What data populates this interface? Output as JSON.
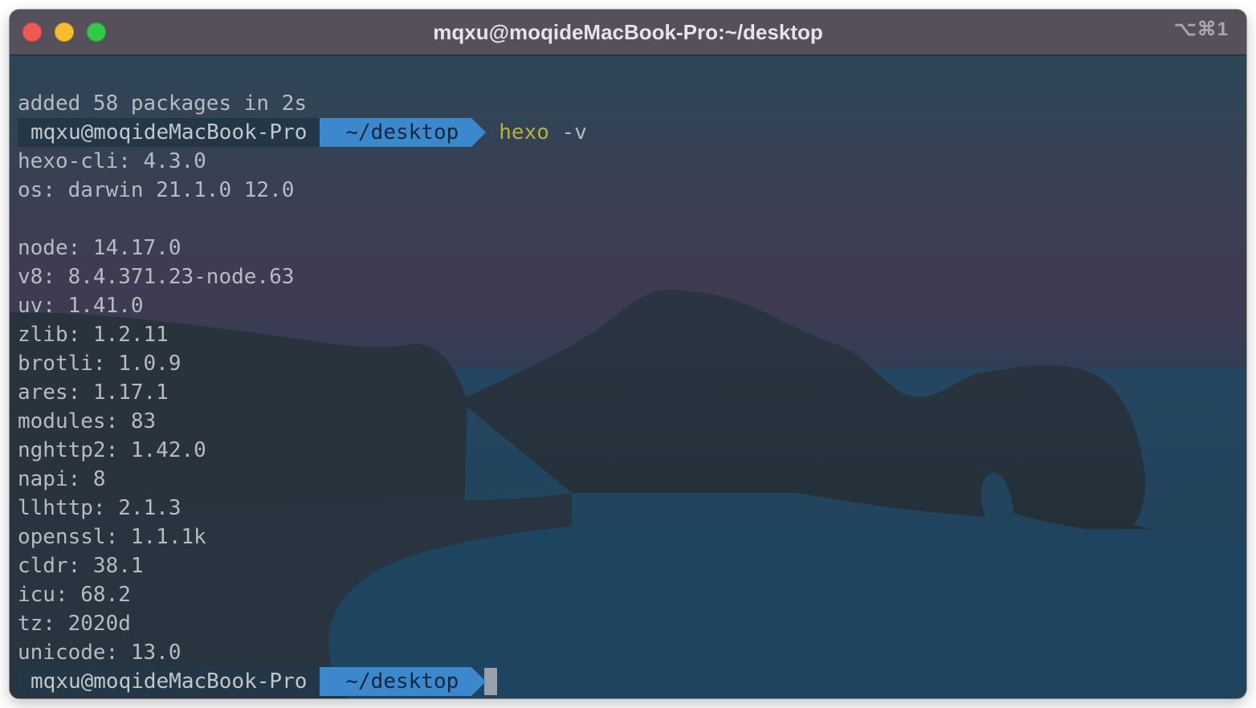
{
  "window": {
    "title": "mqxu@moqideMacBook-Pro:~/desktop",
    "shortcut": "⌥⌘1"
  },
  "terminal": {
    "output_top": "added 58 packages in 2s",
    "prompt1": {
      "user": "mqxu@moqideMacBook-Pro",
      "dir": "~/desktop",
      "command": "hexo",
      "args": "-v"
    },
    "output": [
      "hexo-cli: 4.3.0",
      "os: darwin 21.1.0 12.0",
      "",
      "node: 14.17.0",
      "v8: 8.4.371.23-node.63",
      "uv: 1.41.0",
      "zlib: 1.2.11",
      "brotli: 1.0.9",
      "ares: 1.17.1",
      "modules: 83",
      "nghttp2: 1.42.0",
      "napi: 8",
      "llhttp: 2.1.3",
      "openssl: 1.1.1k",
      "cldr: 38.1",
      "icu: 68.2",
      "tz: 2020d",
      "unicode: 13.0"
    ],
    "prompt2": {
      "user": "mqxu@moqideMacBook-Pro",
      "dir": "~/desktop"
    }
  },
  "colors": {
    "prompt_user_bg": "#233746",
    "prompt_dir_bg": "#3c88cc",
    "command": "#b8b03a",
    "text": "#b6bcc0"
  }
}
